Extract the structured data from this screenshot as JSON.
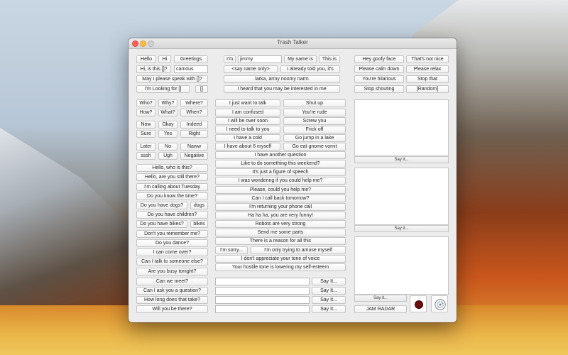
{
  "window": {
    "title": "Trash Talker"
  },
  "left": {
    "greetings_row1": [
      "Hello",
      "Hi",
      "Greetings"
    ],
    "hi_is_this": "Hi, is this []?",
    "hi_is_this_value": "camous",
    "may_i_speak": "May I please speak with []?",
    "looking_for": "I'm Looking for []",
    "bracket_button": "[]",
    "q_row1": [
      "Who?",
      "Why?",
      "Where?"
    ],
    "q_row2": [
      "How?",
      "What?",
      "When?"
    ],
    "a_row1": [
      "Now",
      "Okay",
      "Indeed"
    ],
    "a_row2": [
      "Sure",
      "Yes",
      "Right"
    ],
    "a_row3": [
      "Later",
      "No",
      "Naww"
    ],
    "a_row4": [
      "sssh",
      "Ugh",
      "Negative"
    ],
    "phrases1": [
      "Hello, who is this?",
      "Hello, are you still there?",
      "I'm calling about Tuesday",
      "Do you know the time?"
    ],
    "dogs_q": "Do you have dogs?",
    "dogs_btn": "dogs",
    "children_q": "Do you have children?",
    "bikes_q": "Do you have bikes?",
    "bikes_btn": "bikes",
    "phrases2": [
      "Don't you remember me?",
      "Do you dance?",
      "I can come over?",
      "Can I talk to someone else?",
      "Are you busy tonight?"
    ],
    "phrases3": [
      "Can we meet?",
      "Can I ask you a question?",
      "How long does that take?",
      "Will you be there?"
    ]
  },
  "middle": {
    "im_label": "I'm",
    "name_value": "jimmy",
    "my_name_is": "My name is",
    "this_is": "This is",
    "say_name_only": "<say name only>",
    "already_told": "I already told you, it's",
    "larka": "larka, army noomy narm",
    "heard_that": "I heard that you may be interested in me",
    "left_col": [
      "I just want to talk",
      "I am confused",
      "I will be over soon",
      "I need to talk to you",
      "I have a cold",
      "I have about 6 myself"
    ],
    "right_col": [
      "Shut up",
      "You're rude",
      "Screw you",
      "Frick off",
      "Go jump in a lake",
      "Go eat gnome vomit"
    ],
    "wide": [
      "I have another question",
      "Like to do something this weekend?",
      "It's just a figure of speech",
      "I was wondering if you could help me?",
      "Please, could you help me?",
      "Can I call back tomorrow?",
      "I'm returning your phone call",
      "Ha ha ha, you are very funny!",
      "Robots are very strong",
      "Send me some parts",
      "There is a reason for all this"
    ],
    "im_sorry": "I'm sorry...",
    "amuse": "I'm only trying to amuse myself",
    "wide2": [
      "I don't appreciate your tone of voice",
      "Your hostile tone is lowering my self-esteem"
    ],
    "custom_fields": [
      "",
      "",
      "",
      ""
    ],
    "sayit": "Say It..."
  },
  "right": {
    "insults": [
      [
        "Hey goofy face",
        "That's not nice"
      ],
      [
        "Please calm down",
        "Please relax"
      ],
      [
        "You're hilarious",
        "Stop that"
      ],
      [
        "Stop shouting",
        "[Random]"
      ]
    ],
    "sayit_pane": "Say it...",
    "jam_radar": "JAM RADAR"
  }
}
